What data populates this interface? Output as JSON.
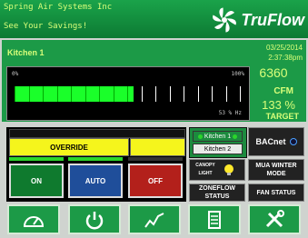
{
  "header": {
    "company": "Spring Air Systems Inc",
    "slogan": "See Your Savings!",
    "logo_text": "TruFlow"
  },
  "status": {
    "zone_name": "Kitchen 1",
    "date": "03/25/2014",
    "time": "2:37:38pm",
    "cfm_value": "6360",
    "cfm_unit": "CFM",
    "percent_value": "133 %",
    "percent_label": "TARGET",
    "meter_min_label": "0%",
    "meter_max_label": "100%",
    "meter_hz_label": "53 % Hz",
    "meter_level": 0.53
  },
  "controls": {
    "override_label": "OVERRIDE",
    "on_label": "ON",
    "auto_label": "AUTO",
    "off_label": "OFF"
  },
  "zones": [
    {
      "label": "Kitchen 1",
      "active": true
    },
    {
      "label": "Kitchen 2",
      "active": false
    }
  ],
  "side_buttons": {
    "bacnet": "BACnet",
    "canopy_light": "CANOPY LIGHT",
    "mua_winter_mode": "MUA WINTER MODE",
    "zoneflow_status": "ZONEFLOW STATUS",
    "fan_status": "FAN STATUS"
  },
  "nav": [
    "speedometer-icon",
    "power-icon",
    "trend-chart-icon",
    "document-icon",
    "tools-icon"
  ],
  "colors": {
    "header_green": "#1aa34a",
    "text_lime": "#d9ff7a",
    "meter_green": "#1aff2a",
    "override_yellow": "#f5f51c",
    "on_green": "#0f7a2e",
    "auto_blue": "#1f4e9a",
    "off_red": "#b3201b"
  }
}
